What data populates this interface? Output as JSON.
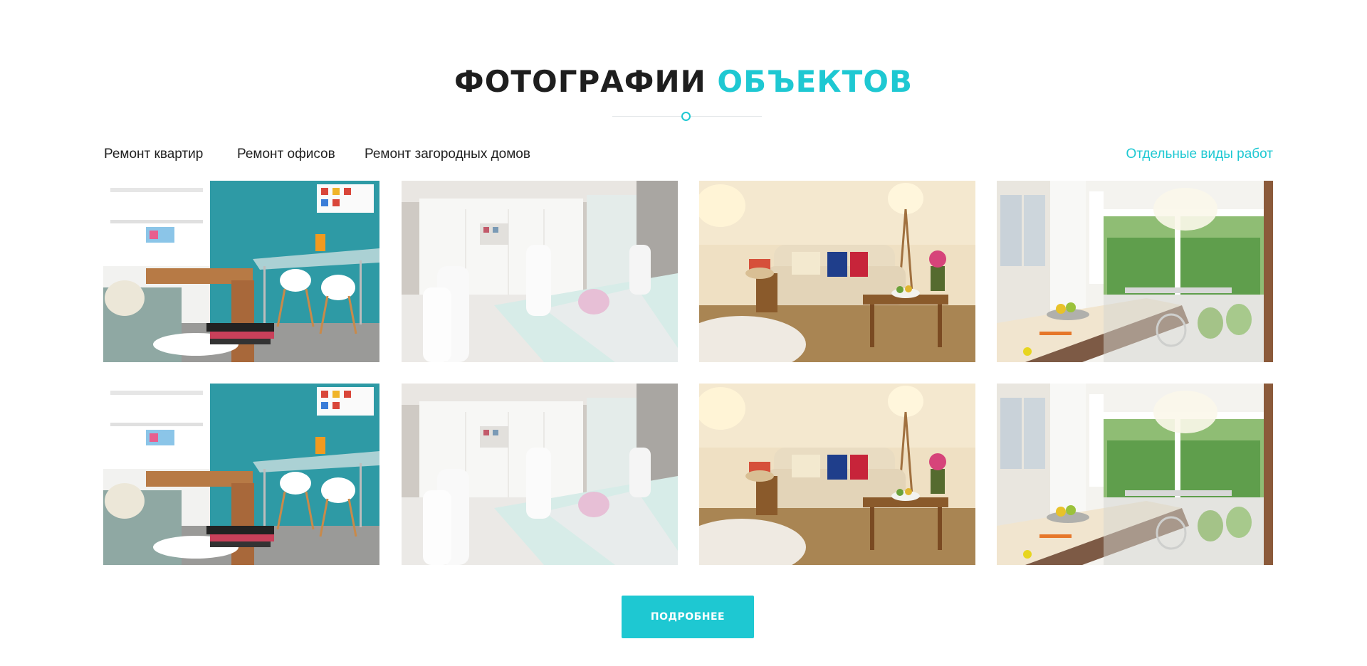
{
  "section": {
    "title_main": "ФОТОГРАФИИ",
    "title_accent": "ОБЪЕКТОВ"
  },
  "filters": [
    {
      "label": "Ремонт квартир"
    },
    {
      "label": "Ремонт офисов"
    },
    {
      "label": "Ремонт загородных домов"
    },
    {
      "label": "Отдельные виды работ"
    }
  ],
  "gallery": {
    "rows": 2,
    "columns": 4
  },
  "button": {
    "label": "ПОДРОБНЕЕ"
  },
  "colors": {
    "accent": "#1ec8d2",
    "text": "#222222",
    "background": "#ffffff"
  }
}
